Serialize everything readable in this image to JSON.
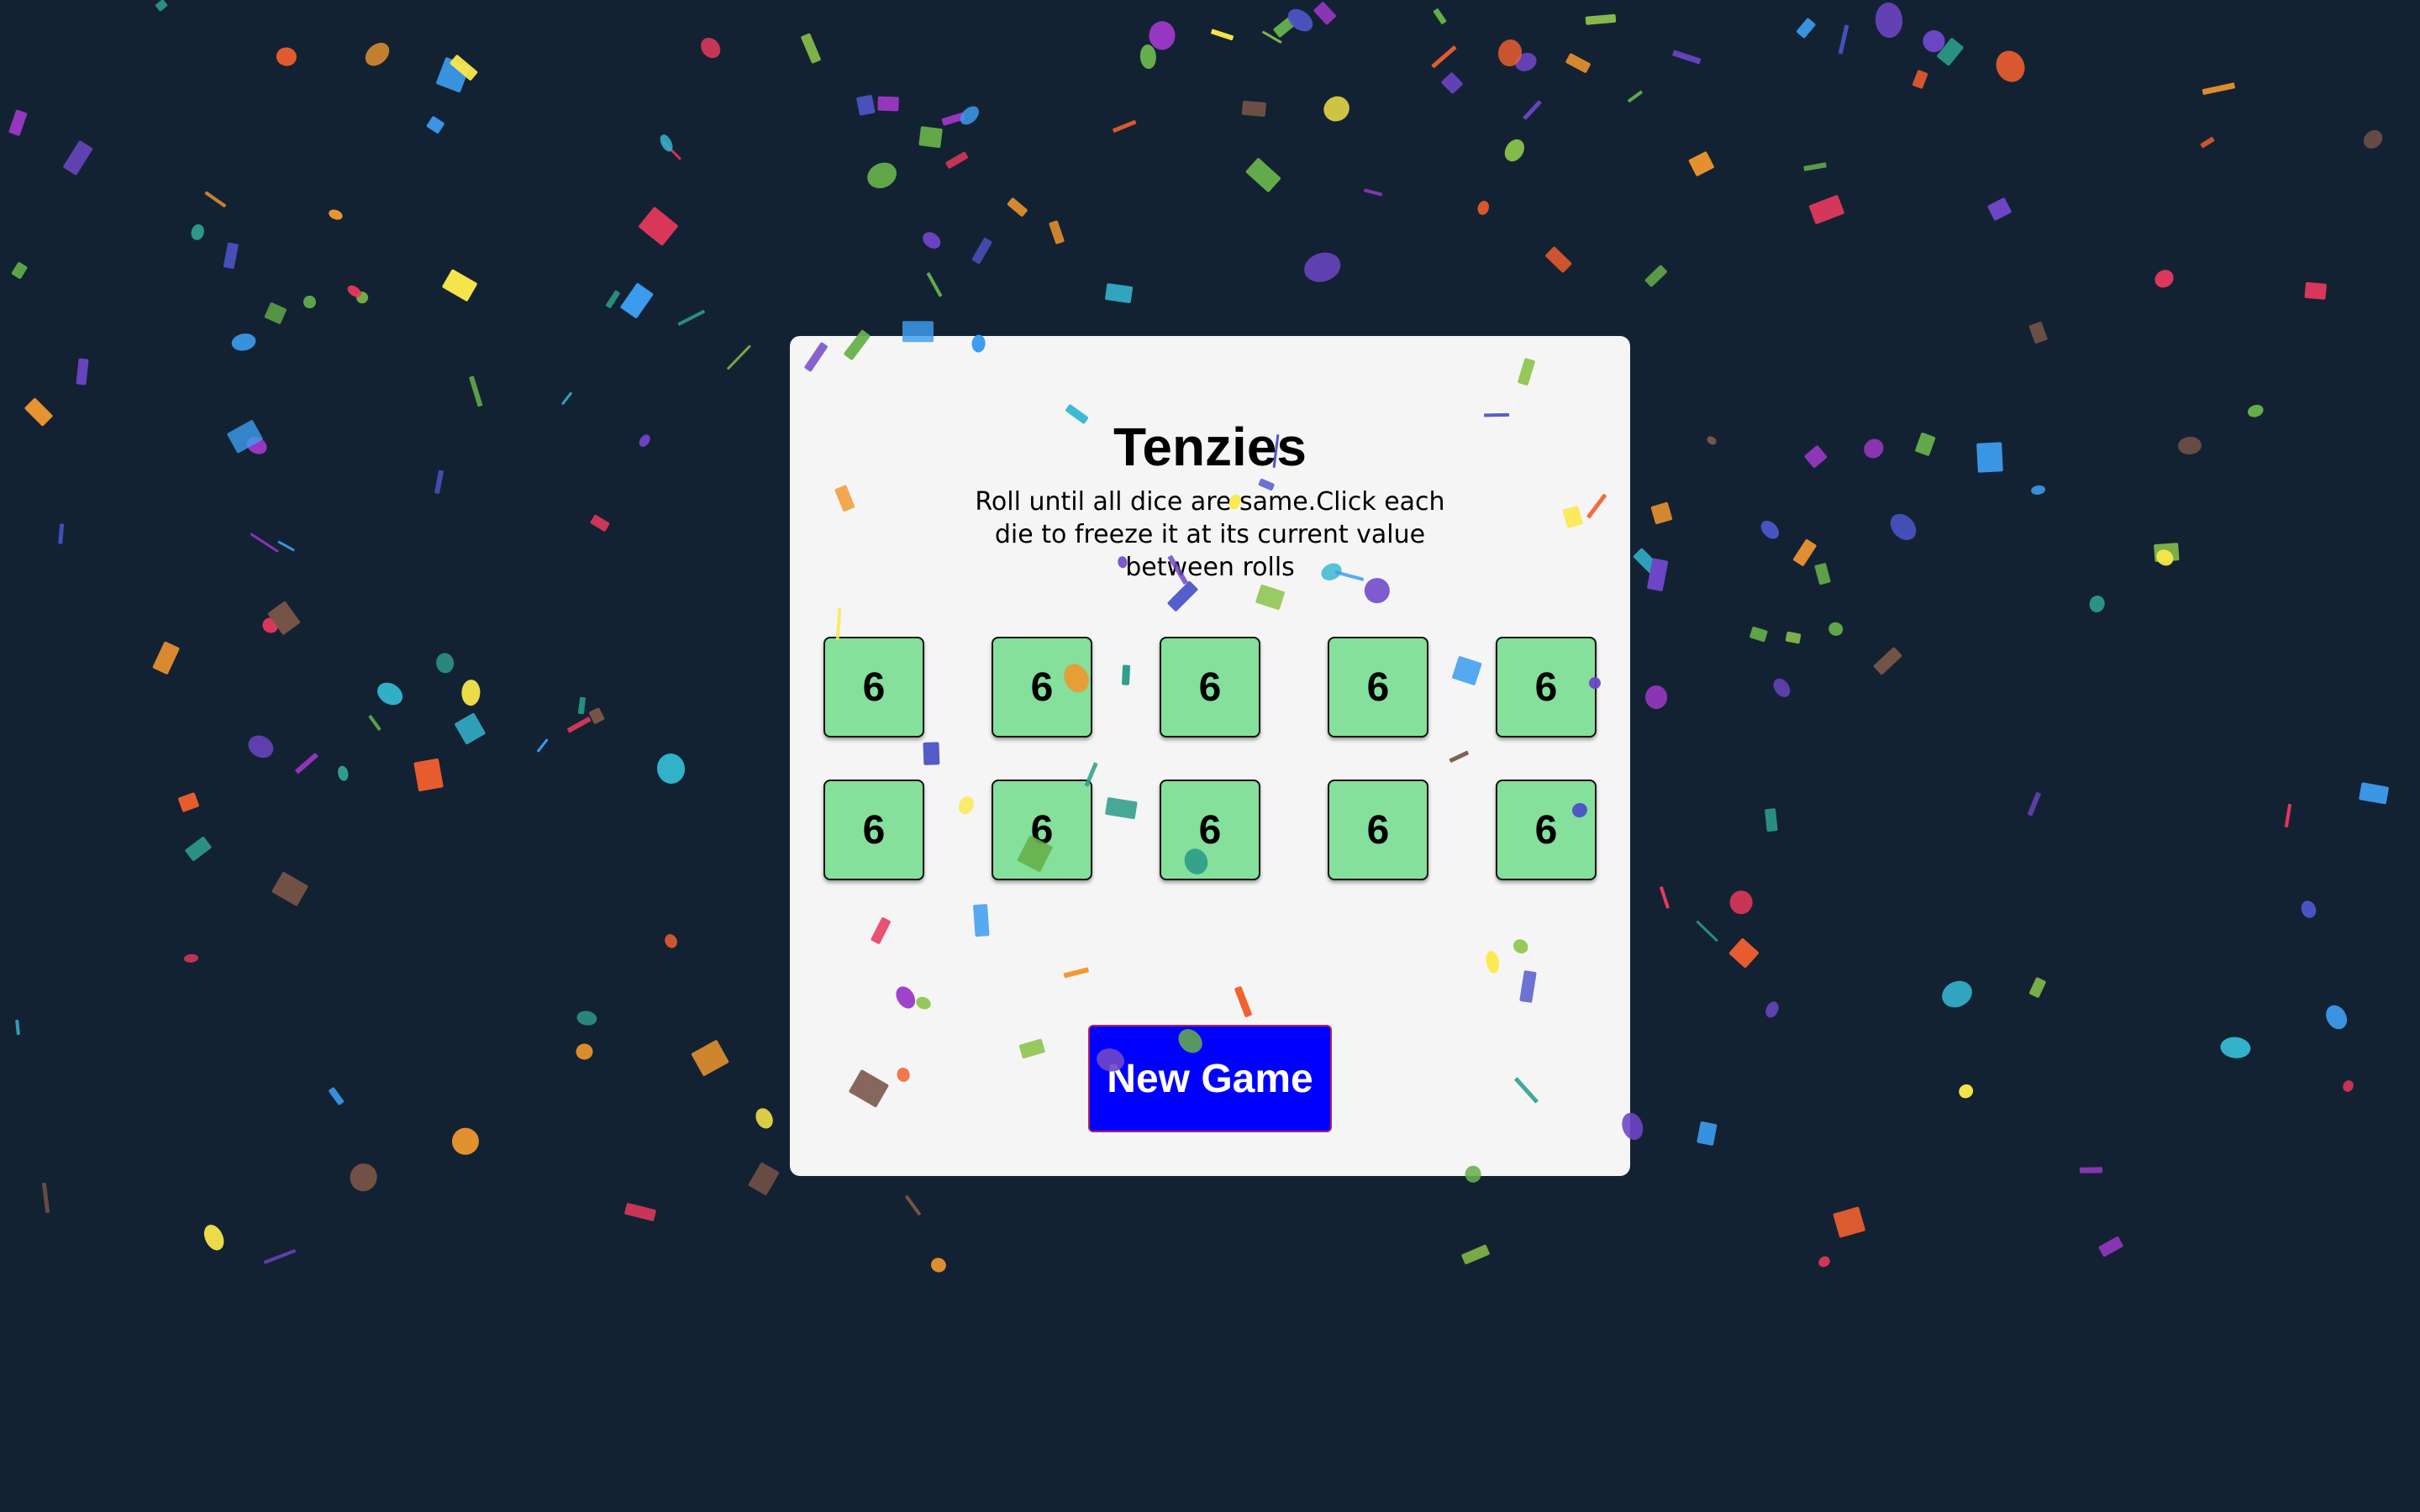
{
  "game": {
    "title": "Tenzies",
    "instructions": "Roll until all dice are same.Click each die to freeze it at its current value between rolls",
    "dice": [
      "6",
      "6",
      "6",
      "6",
      "6",
      "6",
      "6",
      "6",
      "6",
      "6"
    ],
    "new_game_label": "New Game"
  },
  "colors": {
    "background": "#132233",
    "card": "#f5f5f5",
    "die_held": "#84e09b",
    "button": "#0000ff",
    "button_text": "#ffffff"
  },
  "confetti_palette": [
    "#f0972f",
    "#fbe94b",
    "#3d9df0",
    "#e8395d",
    "#6e46c7",
    "#8bc34a",
    "#34b7d0",
    "#f2602f",
    "#2e9e8a",
    "#4d55c8",
    "#795548",
    "#9c38c7",
    "#66b04b"
  ]
}
